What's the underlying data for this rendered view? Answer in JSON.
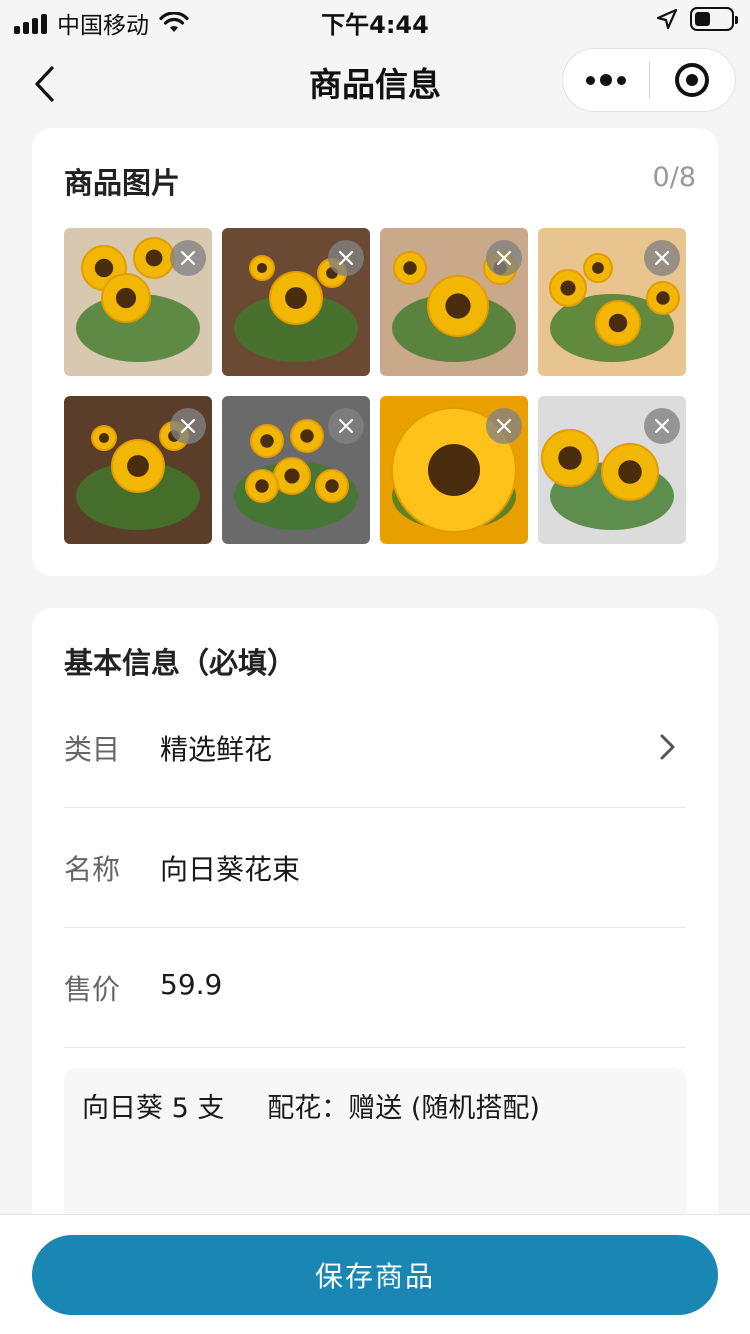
{
  "status_bar": {
    "carrier": "中国移动",
    "time": "下午4:44",
    "battery_level": 0.45
  },
  "nav": {
    "title": "商品信息"
  },
  "photos": {
    "title": "商品图片",
    "count": "0/8",
    "items": [
      {
        "label": "sunflowers-white-vase",
        "bg": "#d9c8b0",
        "accent": "#f2b705"
      },
      {
        "label": "sunflower-bouquet-pink",
        "bg": "#6b4a33",
        "accent": "#f2b705"
      },
      {
        "label": "sunflowers-glass-vase",
        "bg": "#c9a98a",
        "accent": "#f2b705"
      },
      {
        "label": "sunflower-bouquet-white",
        "bg": "#e8c58e",
        "accent": "#f2b705"
      },
      {
        "label": "sunflower-bouquet-pink-2",
        "bg": "#5a3e2a",
        "accent": "#f2b705"
      },
      {
        "label": "sunflower-bouquet-large",
        "bg": "#6a6a6a",
        "accent": "#f2b705"
      },
      {
        "label": "sunflower-closeup",
        "bg": "#e8a000",
        "accent": "#ffc21a"
      },
      {
        "label": "sunflowers-stems",
        "bg": "#dcdcdc",
        "accent": "#f2b705"
      }
    ]
  },
  "basic_info": {
    "title": "基本信息（必填）",
    "category": {
      "label": "类目",
      "value": "精选鲜花"
    },
    "name": {
      "label": "名称",
      "value": "向日葵花束"
    },
    "price": {
      "label": "售价",
      "value": "59.9"
    },
    "description": "向日葵 5 支     配花：赠送 (随机搭配)"
  },
  "footer": {
    "save_label": "保存商品"
  },
  "colors": {
    "accent": "#1a86b3",
    "background": "#f5f5f5"
  }
}
